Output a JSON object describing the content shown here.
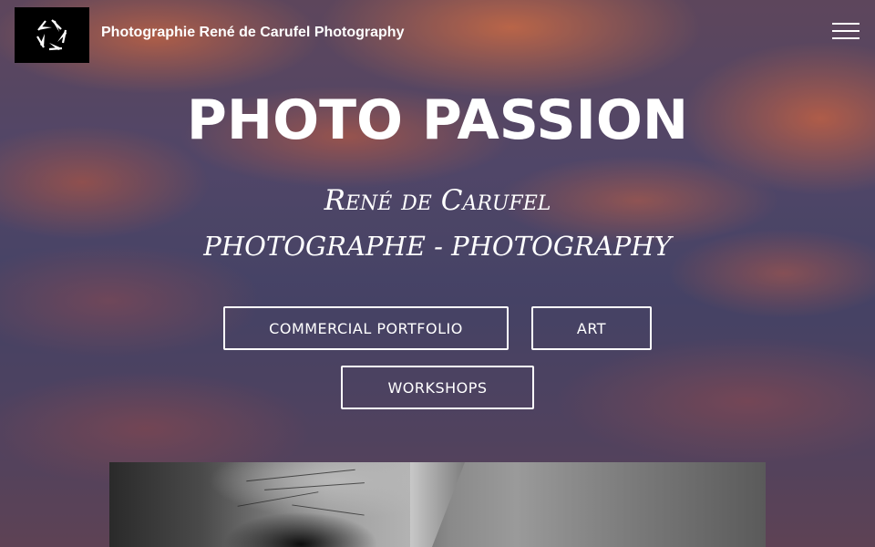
{
  "header": {
    "site_title": "Photographie René de Carufel Photography",
    "logo_icon": "aperture-icon",
    "menu_icon": "hamburger-menu-icon"
  },
  "hero": {
    "title": "PHOTO PASSION",
    "subtitle_line1": "René de Carufel",
    "subtitle_line2": "PHOTOGRAPHE - PHOTOGRAPHY"
  },
  "buttons": {
    "commercial": "COMMERCIAL PORTFOLIO",
    "art": "ART",
    "workshops": "WORKSHOPS"
  },
  "colors": {
    "text": "#ffffff",
    "logo_background": "#000000",
    "sky_orange": "#e07848",
    "sky_purple": "#4c4a6e"
  }
}
